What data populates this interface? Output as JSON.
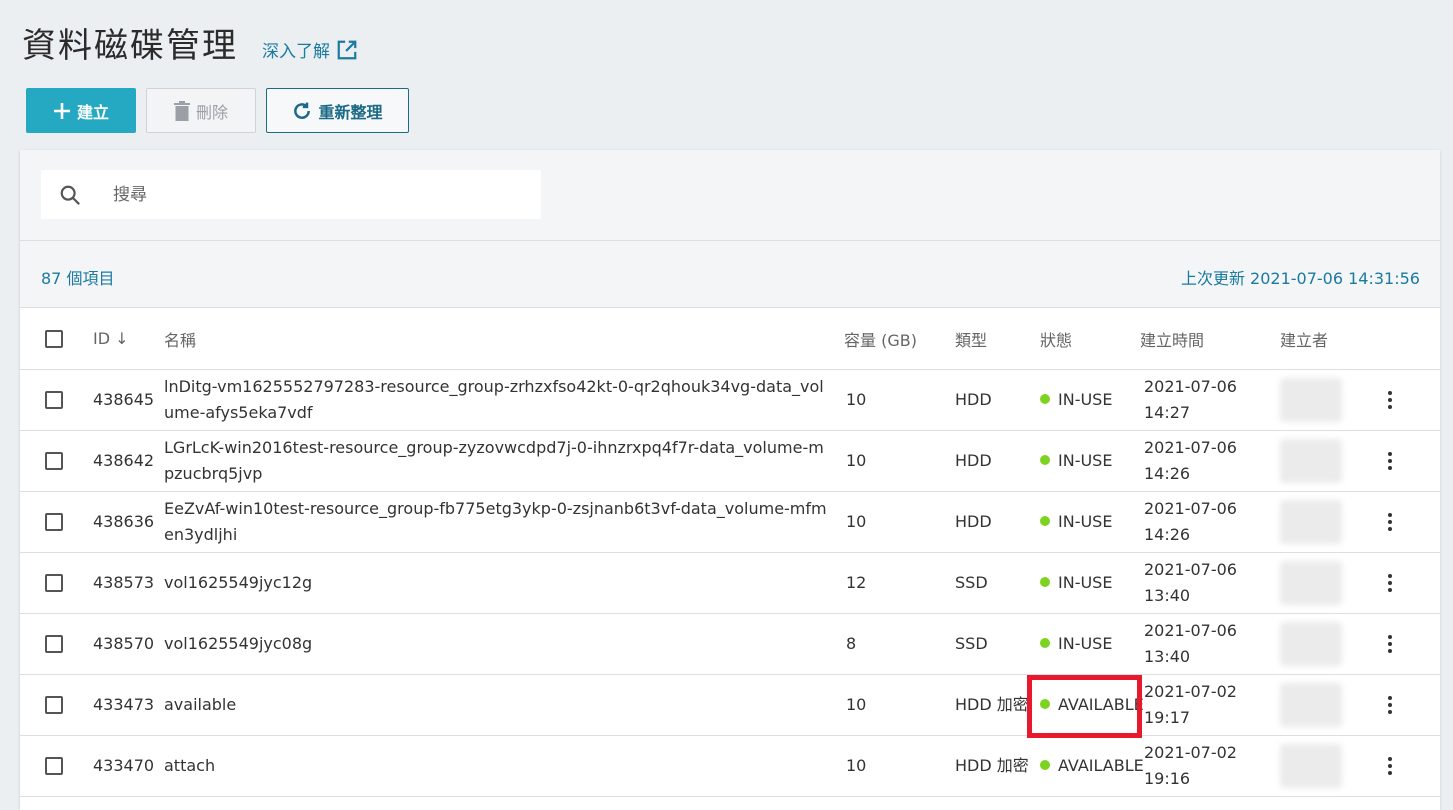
{
  "header": {
    "title": "資料磁碟管理",
    "learn_more": "深入了解"
  },
  "toolbar": {
    "create_label": "建立",
    "delete_label": "刪除",
    "refresh_label": "重新整理"
  },
  "search": {
    "placeholder": "搜尋"
  },
  "summary": {
    "count": "87 個項目",
    "last_updated": "上次更新 2021-07-06 14:31:56"
  },
  "table": {
    "columns": {
      "id": "ID",
      "name": "名稱",
      "capacity": "容量 (GB)",
      "type": "類型",
      "status": "狀態",
      "created": "建立時間",
      "creator": "建立者"
    },
    "sort": {
      "column": "ID",
      "direction": "descending"
    },
    "rows": [
      {
        "id": "438645",
        "name": "lnDitg-vm1625552797283-resource_group-zrhzxfso42kt-0-qr2qhouk34vg-data_volume-afys5eka7vdf",
        "capacity": "10",
        "type": "HDD",
        "status": "IN-USE",
        "created": "2021-07-06 14:27"
      },
      {
        "id": "438642",
        "name": "LGrLcK-win2016test-resource_group-zyzovwcdpd7j-0-ihnzrxpq4f7r-data_volume-mpzucbrq5jvp",
        "capacity": "10",
        "type": "HDD",
        "status": "IN-USE",
        "created": "2021-07-06 14:26"
      },
      {
        "id": "438636",
        "name": "EeZvAf-win10test-resource_group-fb775etg3ykp-0-zsjnanb6t3vf-data_volume-mfmen3ydljhi",
        "capacity": "10",
        "type": "HDD",
        "status": "IN-USE",
        "created": "2021-07-06 14:26"
      },
      {
        "id": "438573",
        "name": "vol1625549jyc12g",
        "capacity": "12",
        "type": "SSD",
        "status": "IN-USE",
        "created": "2021-07-06 13:40"
      },
      {
        "id": "438570",
        "name": "vol1625549jyc08g",
        "capacity": "8",
        "type": "SSD",
        "status": "IN-USE",
        "created": "2021-07-06 13:40"
      },
      {
        "id": "433473",
        "name": "available",
        "capacity": "10",
        "type": "HDD 加密",
        "status": "AVAILABLE",
        "created": "2021-07-02 19:17"
      },
      {
        "id": "433470",
        "name": "attach",
        "capacity": "10",
        "type": "HDD 加密",
        "status": "AVAILABLE",
        "created": "2021-07-02 19:16"
      }
    ]
  },
  "colors": {
    "accent": "#25a8c2",
    "link": "#1a7aa0",
    "status_dot": "#7ed321",
    "highlight": "#e8192c"
  }
}
